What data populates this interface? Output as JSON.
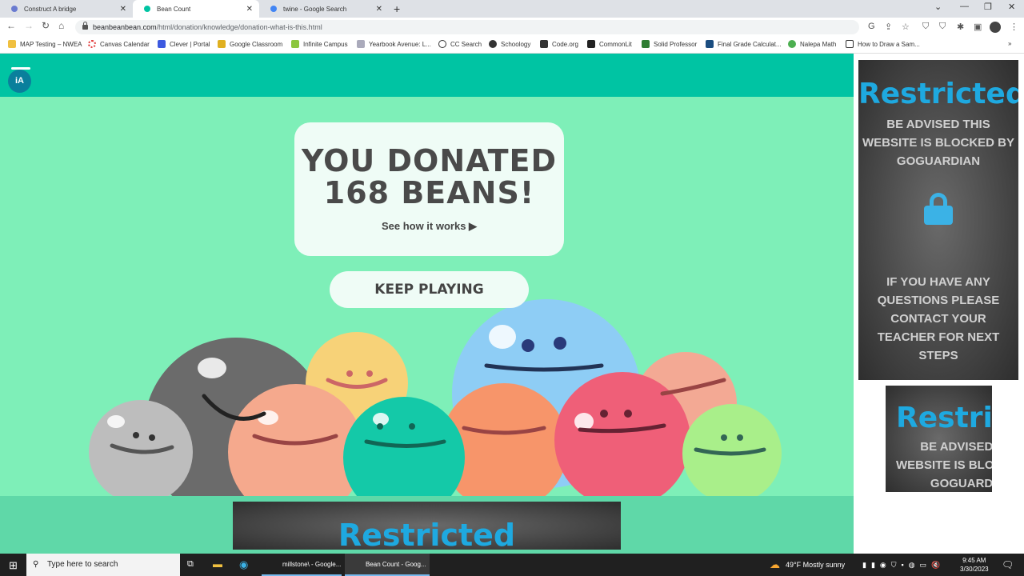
{
  "tabs": [
    {
      "title": "Construct A bridge"
    },
    {
      "title": "Bean Count",
      "active": true
    },
    {
      "title": "twine - Google Search"
    }
  ],
  "address": {
    "domain": "beanbeanbean.com",
    "path": "/html/donation/knowledge/donation-what-is-this.html"
  },
  "bookmarks": [
    "MAP Testing – NWEA",
    "Canvas Calendar",
    "Clever | Portal",
    "Google Classroom",
    "Infinite Campus",
    "Yearbook Avenue: L...",
    "CC Search",
    "Schoology",
    "Code.org",
    "CommonLit",
    "Solid Professor",
    "Final Grade Calculat...",
    "Nalepa Math",
    "How to Draw a Sam..."
  ],
  "page": {
    "logo": "iA",
    "donated_line1": "YOU DONATED",
    "donated_line2": "168 BEANS!",
    "see_how": "See how it works ▶",
    "keep_playing": "KEEP PLAYING"
  },
  "restricted": {
    "title": "Restricted",
    "line1": "BE ADVISED THIS WEBSITE IS BLOCKED BY GOGUARDIAN",
    "line2": "IF YOU HAVE ANY QUESTIONS PLEASE CONTACT YOUR TEACHER FOR NEXT STEPS",
    "small_line": "BE ADVISED THIS WEBSITE IS BLOCKED BY GOGUARDIAN"
  },
  "taskbar": {
    "search": "Type here to search",
    "apps": [
      "millstone\\ - Google...",
      "Bean Count - Goog..."
    ],
    "weather": "49°F  Mostly sunny",
    "time": "9:45 AM",
    "date": "3/30/2023"
  },
  "colors": {
    "header": "#00c4a3",
    "bg": "#7eefb8",
    "restricted": "#1ea9e0"
  }
}
